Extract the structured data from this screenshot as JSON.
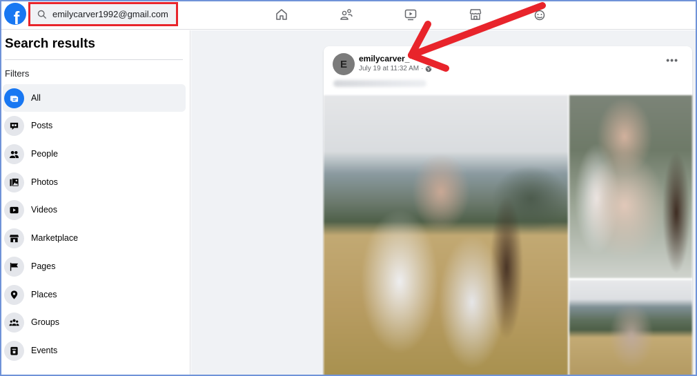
{
  "topbar": {
    "logo": "f",
    "search": {
      "value": "emilycarver1992@gmail.com",
      "icon": "search-icon"
    },
    "nav": [
      {
        "name": "home",
        "icon": "home-icon"
      },
      {
        "name": "friends",
        "icon": "friends-icon"
      },
      {
        "name": "watch",
        "icon": "video-icon"
      },
      {
        "name": "marketplace",
        "icon": "marketplace-icon"
      },
      {
        "name": "gaming",
        "icon": "gaming-icon"
      }
    ]
  },
  "sidebar": {
    "title": "Search results",
    "filters_label": "Filters",
    "items": [
      {
        "label": "All",
        "icon": "all-icon",
        "active": true
      },
      {
        "label": "Posts",
        "icon": "posts-icon"
      },
      {
        "label": "People",
        "icon": "people-icon"
      },
      {
        "label": "Photos",
        "icon": "photos-icon"
      },
      {
        "label": "Videos",
        "icon": "videos-icon"
      },
      {
        "label": "Marketplace",
        "icon": "marketplace-icon"
      },
      {
        "label": "Pages",
        "icon": "flag-icon"
      },
      {
        "label": "Places",
        "icon": "location-pin-icon"
      },
      {
        "label": "Groups",
        "icon": "groups-icon"
      },
      {
        "label": "Events",
        "icon": "calendar-icon"
      }
    ]
  },
  "post": {
    "avatar_initial": "E",
    "author": "emilycarver_",
    "timestamp": "July 19 at 11:32 AM",
    "separator": "·",
    "audience_icon": "globe-icon",
    "more": "•••",
    "caption_blurred": true,
    "photos": [
      "blurred couple in field",
      "blurred couple closeup",
      "blurred field landscape"
    ]
  },
  "annotation": {
    "arrow_color": "#e8242b",
    "highlight_color": "#e8242b"
  },
  "colors": {
    "brand": "#1877f2",
    "background": "#f0f2f5"
  }
}
